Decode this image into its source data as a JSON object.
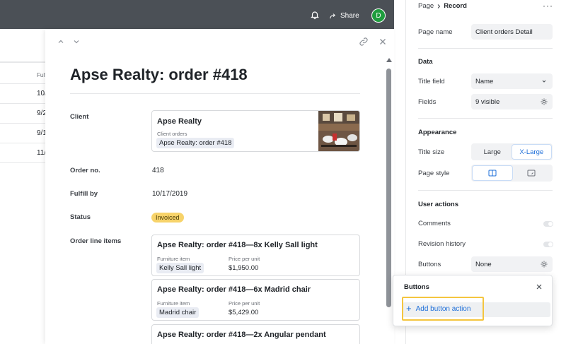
{
  "topbar": {
    "share_label": "Share",
    "avatar_initial": "D",
    "avatar_color": "#1f9d3e"
  },
  "background_grid": {
    "column_header": "Fulfi",
    "cells": [
      "10/",
      "9/2",
      "9/1",
      "11/"
    ]
  },
  "record": {
    "title": "Apse Realty: order #418",
    "fields": {
      "client_label": "Client",
      "order_no_label": "Order no.",
      "order_no_value": "418",
      "fulfill_by_label": "Fulfill by",
      "fulfill_by_value": "10/17/2019",
      "status_label": "Status",
      "status_value": "Invoiced",
      "line_items_label": "Order line items"
    },
    "client_card": {
      "name": "Apse Realty",
      "sub_label": "Client orders",
      "chip": "Apse Realty: order #418"
    },
    "line_items": [
      {
        "title": "Apse Realty: order #418—8x Kelly Sall light",
        "item_col": "Furniture item",
        "price_col": "Price per unit",
        "item": "Kelly Sall light",
        "price": "$1,950.00"
      },
      {
        "title": "Apse Realty: order #418—6x Madrid chair",
        "item_col": "Furniture item",
        "price_col": "Price per unit",
        "item": "Madrid chair",
        "price": "$5,429.00"
      },
      {
        "title": "Apse Realty: order #418—2x Angular pendant"
      }
    ],
    "status_color": "#f7d36a"
  },
  "properties": {
    "breadcrumb_parent": "Page",
    "breadcrumb_current": "Record",
    "page_name_label": "Page name",
    "page_name_value": "Client orders Detail",
    "data_section": "Data",
    "title_field_label": "Title field",
    "title_field_value": "Name",
    "fields_label": "Fields",
    "fields_value": "9 visible",
    "appearance_section": "Appearance",
    "title_size_label": "Title size",
    "title_size_options": [
      "Large",
      "X-Large"
    ],
    "title_size_selected": "X-Large",
    "page_style_label": "Page style",
    "user_actions_section": "User actions",
    "comments_label": "Comments",
    "revision_history_label": "Revision history",
    "buttons_label": "Buttons",
    "buttons_value": "None"
  },
  "buttons_popover": {
    "title": "Buttons",
    "add_label": "Add button action",
    "accent_color": "#1e6fd9",
    "highlight_color": "#f4c53f"
  }
}
